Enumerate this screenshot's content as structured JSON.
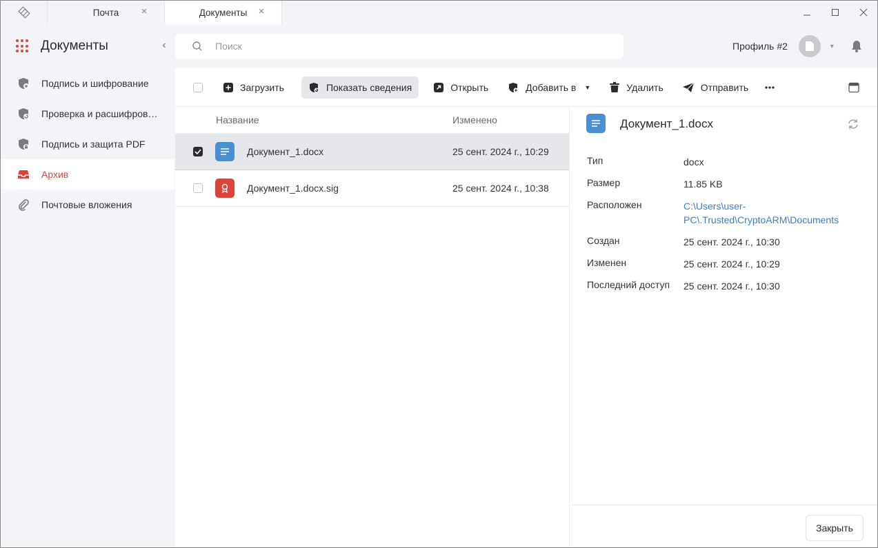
{
  "tabs": [
    {
      "label": "Почта",
      "active": false
    },
    {
      "label": "Документы",
      "active": true
    }
  ],
  "sidebar": {
    "title": "Документы",
    "items": [
      {
        "label": "Подпись и шифрование",
        "icon": "shield-icon",
        "active": false
      },
      {
        "label": "Проверка и расшифров…",
        "icon": "shield-check-icon",
        "active": false
      },
      {
        "label": "Подпись и защита PDF",
        "icon": "shield-lock-icon",
        "active": false
      },
      {
        "label": "Архив",
        "icon": "inbox-icon",
        "active": true
      },
      {
        "label": "Почтовые вложения",
        "icon": "paperclip-icon",
        "active": false
      }
    ]
  },
  "search": {
    "placeholder": "Поиск",
    "value": ""
  },
  "profile": {
    "name": "Профиль #2"
  },
  "toolbar": {
    "upload": "Загрузить",
    "show_details": "Показать сведения",
    "open": "Открыть",
    "add_to": "Добавить в",
    "delete": "Удалить",
    "send": "Отправить"
  },
  "file_list": {
    "columns": {
      "name": "Название",
      "modified": "Изменено"
    },
    "rows": [
      {
        "name": "Документ_1.docx",
        "modified": "25 сент. 2024 г., 10:29",
        "selected": true,
        "icon": "document-icon",
        "icon_color": "#4a8fd4"
      },
      {
        "name": "Документ_1.docx.sig",
        "modified": "25 сент. 2024 г., 10:38",
        "selected": false,
        "icon": "signature-icon",
        "icon_color": "#d9453a"
      }
    ]
  },
  "details": {
    "title": "Документ_1.docx",
    "properties": [
      {
        "label": "Тип",
        "value": "docx"
      },
      {
        "label": "Размер",
        "value": "11.85 KB"
      },
      {
        "label": "Расположен",
        "value": "C:\\Users\\user-PC\\.Trusted\\CryptoARM\\Documents",
        "link": true
      },
      {
        "label": "Создан",
        "value": "25 сент. 2024 г., 10:30"
      },
      {
        "label": "Изменен",
        "value": "25 сент. 2024 г., 10:29"
      },
      {
        "label": "Последний доступ",
        "value": "25 сент. 2024 г., 10:30"
      }
    ],
    "close_label": "Закрыть"
  },
  "colors": {
    "accent": "#d9453a",
    "doc_icon": "#4a8fd4",
    "link": "#3b7ec8",
    "selection": "#e6e7ea"
  }
}
